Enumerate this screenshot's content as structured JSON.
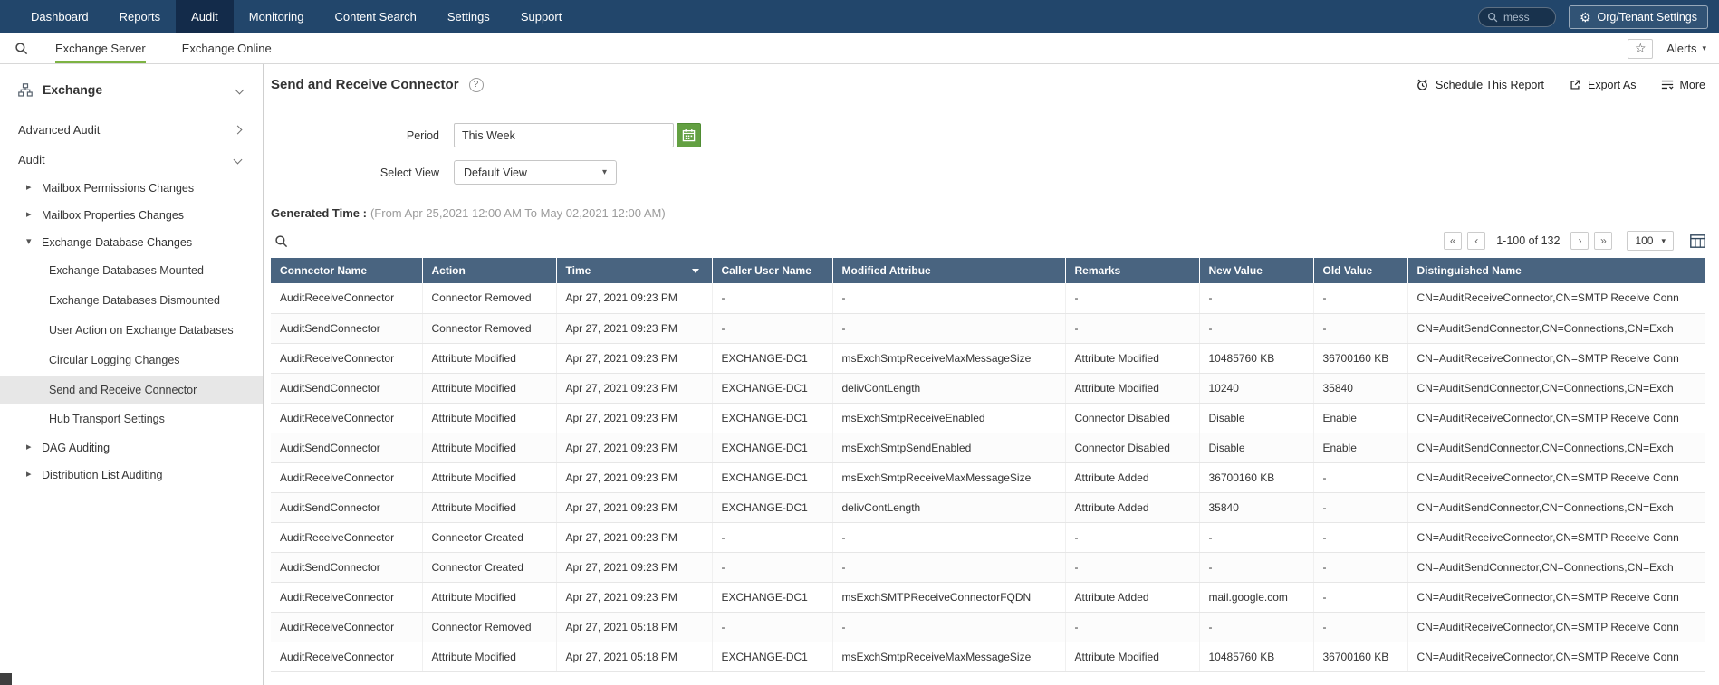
{
  "colors": {
    "accent_green": "#7db343",
    "top_nav_bg": "#22466b",
    "top_nav_active_bg": "#132b4a",
    "table_header_bg": "#496480",
    "calendar_button_bg": "#63a042",
    "selected_item_bg": "#e7e7e7"
  },
  "icons": {
    "gear": "⚙",
    "star": "☆",
    "help": "?",
    "caret_down": "▾",
    "triangle_right": "▸",
    "triangle_down": "▾",
    "first": "«",
    "prev": "‹",
    "next": "›",
    "last": "»"
  },
  "top_nav": {
    "tabs": [
      "Dashboard",
      "Reports",
      "Audit",
      "Monitoring",
      "Content Search",
      "Settings",
      "Support"
    ],
    "active_tab_index": 2,
    "search_value": "mess",
    "org_settings_label": "Org/Tenant Settings"
  },
  "sub_nav": {
    "tabs": [
      "Exchange Server",
      "Exchange Online"
    ],
    "active_tab_index": 0,
    "alerts_label": "Alerts"
  },
  "sidebar": {
    "section_title": "Exchange",
    "items": [
      {
        "label": "Advanced Audit",
        "level": 0,
        "state": "collapsed"
      },
      {
        "label": "Audit",
        "level": 0,
        "state": "expanded"
      },
      {
        "label": "Mailbox Permissions Changes",
        "level": 1,
        "state": "collapsed"
      },
      {
        "label": "Mailbox Properties Changes",
        "level": 1,
        "state": "collapsed"
      },
      {
        "label": "Exchange Database Changes",
        "level": 1,
        "state": "expanded"
      },
      {
        "label": "Exchange Databases Mounted",
        "level": 2,
        "state": "leaf"
      },
      {
        "label": "Exchange Databases Dismounted",
        "level": 2,
        "state": "leaf"
      },
      {
        "label": "User Action on Exchange Databases",
        "level": 2,
        "state": "leaf"
      },
      {
        "label": "Circular Logging Changes",
        "level": 2,
        "state": "leaf"
      },
      {
        "label": "Send and Receive Connector",
        "level": 2,
        "state": "leaf",
        "selected": true
      },
      {
        "label": "Hub Transport Settings",
        "level": 2,
        "state": "leaf"
      },
      {
        "label": "DAG Auditing",
        "level": 1,
        "state": "collapsed"
      },
      {
        "label": "Distribution List Auditing",
        "level": 1,
        "state": "collapsed"
      }
    ]
  },
  "report": {
    "title": "Send and Receive Connector",
    "actions": [
      "Schedule This Report",
      "Export As",
      "More"
    ],
    "filters": {
      "period_label": "Period",
      "period_value": "This Week",
      "view_label": "Select View",
      "view_value": "Default View"
    },
    "generated_label": "Generated Time :",
    "generated_value": "(From Apr 25,2021 12:00 AM To May 02,2021 12:00 AM)",
    "pagination": {
      "range": "1-100 of 132",
      "page_size": "100"
    }
  },
  "table": {
    "columns": [
      "Connector Name",
      "Action",
      "Time",
      "Caller User Name",
      "Modified Attribue",
      "Remarks",
      "New Value",
      "Old Value",
      "Distinguished Name"
    ],
    "sorted_column": "Time",
    "sort_direction": "desc",
    "rows": [
      [
        "AuditReceiveConnector",
        "Connector Removed",
        "Apr 27, 2021 09:23 PM",
        "-",
        "-",
        "-",
        "-",
        "-",
        "CN=AuditReceiveConnector,CN=SMTP Receive Conn"
      ],
      [
        "AuditSendConnector",
        "Connector Removed",
        "Apr 27, 2021 09:23 PM",
        "-",
        "-",
        "-",
        "-",
        "-",
        "CN=AuditSendConnector,CN=Connections,CN=Exch"
      ],
      [
        "AuditReceiveConnector",
        "Attribute Modified",
        "Apr 27, 2021 09:23 PM",
        "EXCHANGE-DC1",
        "msExchSmtpReceiveMaxMessageSize",
        "Attribute Modified",
        "10485760 KB",
        "36700160 KB",
        "CN=AuditReceiveConnector,CN=SMTP Receive Conn"
      ],
      [
        "AuditSendConnector",
        "Attribute Modified",
        "Apr 27, 2021 09:23 PM",
        "EXCHANGE-DC1",
        "delivContLength",
        "Attribute Modified",
        "10240",
        "35840",
        "CN=AuditSendConnector,CN=Connections,CN=Exch"
      ],
      [
        "AuditReceiveConnector",
        "Attribute Modified",
        "Apr 27, 2021 09:23 PM",
        "EXCHANGE-DC1",
        "msExchSmtpReceiveEnabled",
        "Connector Disabled",
        "Disable",
        "Enable",
        "CN=AuditReceiveConnector,CN=SMTP Receive Conn"
      ],
      [
        "AuditSendConnector",
        "Attribute Modified",
        "Apr 27, 2021 09:23 PM",
        "EXCHANGE-DC1",
        "msExchSmtpSendEnabled",
        "Connector Disabled",
        "Disable",
        "Enable",
        "CN=AuditSendConnector,CN=Connections,CN=Exch"
      ],
      [
        "AuditReceiveConnector",
        "Attribute Modified",
        "Apr 27, 2021 09:23 PM",
        "EXCHANGE-DC1",
        "msExchSmtpReceiveMaxMessageSize",
        "Attribute Added",
        "36700160 KB",
        "-",
        "CN=AuditReceiveConnector,CN=SMTP Receive Conn"
      ],
      [
        "AuditSendConnector",
        "Attribute Modified",
        "Apr 27, 2021 09:23 PM",
        "EXCHANGE-DC1",
        "delivContLength",
        "Attribute Added",
        "35840",
        "-",
        "CN=AuditSendConnector,CN=Connections,CN=Exch"
      ],
      [
        "AuditReceiveConnector",
        "Connector Created",
        "Apr 27, 2021 09:23 PM",
        "-",
        "-",
        "-",
        "-",
        "-",
        "CN=AuditReceiveConnector,CN=SMTP Receive Conn"
      ],
      [
        "AuditSendConnector",
        "Connector Created",
        "Apr 27, 2021 09:23 PM",
        "-",
        "-",
        "-",
        "-",
        "-",
        "CN=AuditSendConnector,CN=Connections,CN=Exch"
      ],
      [
        "AuditReceiveConnector",
        "Attribute Modified",
        "Apr 27, 2021 09:23 PM",
        "EXCHANGE-DC1",
        "msExchSMTPReceiveConnectorFQDN",
        "Attribute Added",
        "mail.google.com",
        "-",
        "CN=AuditReceiveConnector,CN=SMTP Receive Conn"
      ],
      [
        "AuditReceiveConnector",
        "Connector Removed",
        "Apr 27, 2021 05:18 PM",
        "-",
        "-",
        "-",
        "-",
        "-",
        "CN=AuditReceiveConnector,CN=SMTP Receive Conn"
      ],
      [
        "AuditReceiveConnector",
        "Attribute Modified",
        "Apr 27, 2021 05:18 PM",
        "EXCHANGE-DC1",
        "msExchSmtpReceiveMaxMessageSize",
        "Attribute Modified",
        "10485760 KB",
        "36700160 KB",
        "CN=AuditReceiveConnector,CN=SMTP Receive Conn"
      ]
    ]
  }
}
